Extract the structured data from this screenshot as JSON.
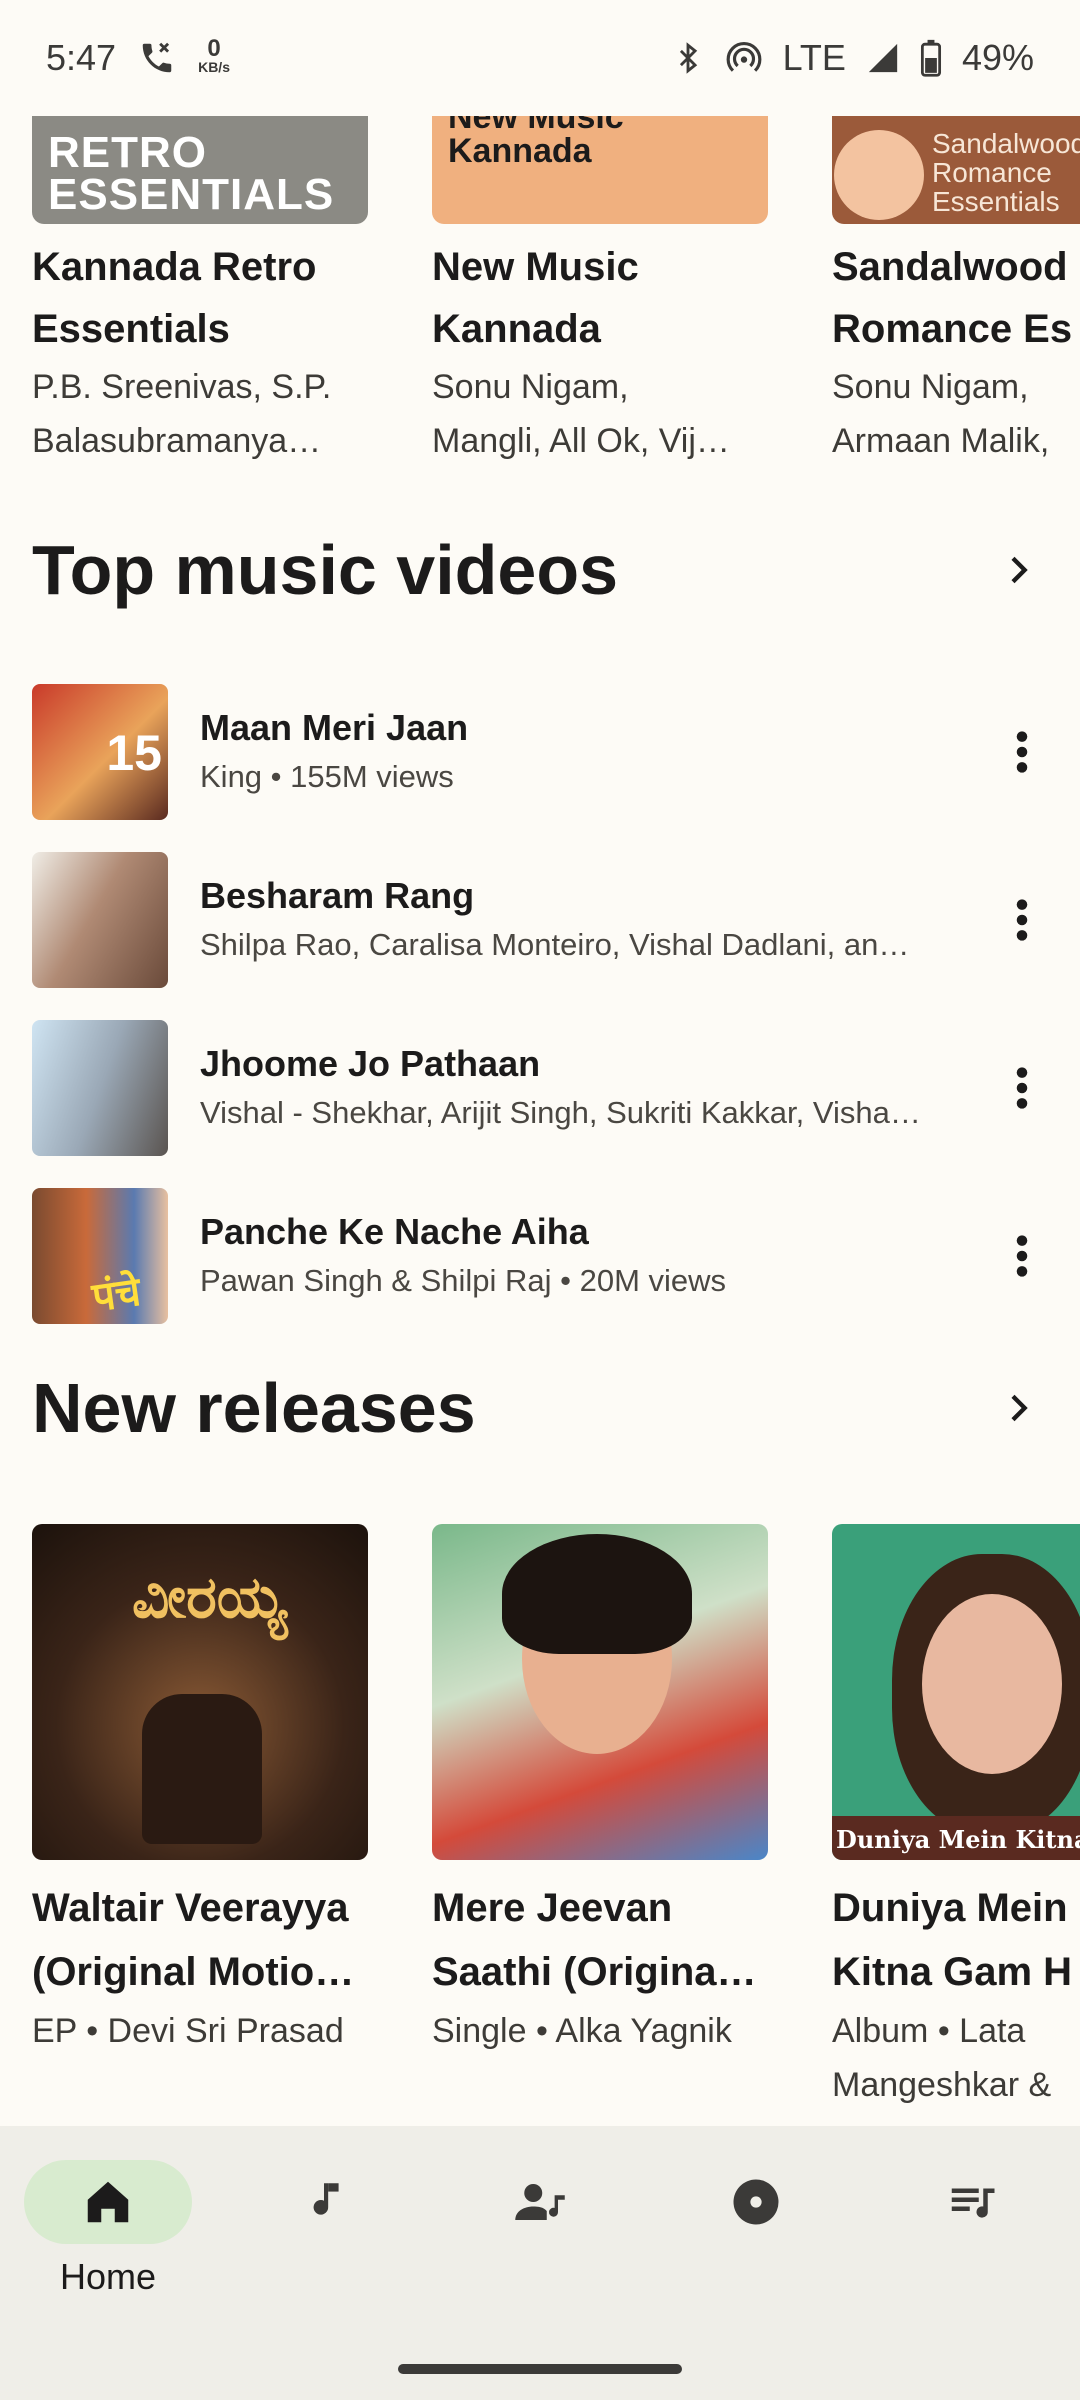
{
  "status_bar": {
    "time": "5:47",
    "data_rate_value": "0",
    "data_rate_unit": "KB/s",
    "network": "LTE",
    "battery": "49%"
  },
  "top_playlists": [
    {
      "art_text": "RETRO\nESSENTIALS",
      "title_line1": "Kannada Retro",
      "title_line2": "Essentials",
      "sub_line1": "P.B. Sreenivas, S.P.",
      "sub_line2": "Balasubramanya…"
    },
    {
      "art_text": "New Music\nKannada",
      "title_line1": "New Music",
      "title_line2": "Kannada",
      "sub_line1": "Sonu Nigam,",
      "sub_line2": "Mangli, All Ok, Vij…"
    },
    {
      "art_text": "Sandalwood\nRomance\nEssentials",
      "title_line1": "Sandalwood",
      "title_line2": "Romance Es",
      "sub_line1": "Sonu Nigam,",
      "sub_line2": "Armaan Malik,"
    }
  ],
  "top_videos": {
    "title": "Top music videos",
    "items": [
      {
        "title": "Maan Meri Jaan",
        "subtitle": "King • 155M views"
      },
      {
        "title": "Besharam Rang",
        "subtitle": "Shilpa Rao, Caralisa Monteiro, Vishal Dadlani, and…"
      },
      {
        "title": "Jhoome Jo Pathaan",
        "subtitle": "Vishal - Shekhar, Arijit Singh, Sukriti Kakkar, Vishal…"
      },
      {
        "title": "Panche Ke Nache Aiha",
        "subtitle": "Pawan Singh & Shilpi Raj • 20M views"
      }
    ]
  },
  "new_releases": {
    "title": "New releases",
    "items": [
      {
        "title_line1": "Waltair Veerayya",
        "title_line2": "(Original Motio…",
        "sub_line1": "EP • Devi Sri Prasad",
        "sub_line2": ""
      },
      {
        "title_line1": "Mere Jeevan",
        "title_line2": "Saathi (Origina…",
        "sub_line1": "Single • Alka Yagnik",
        "sub_line2": ""
      },
      {
        "title_line1": "Duniya Mein",
        "title_line2": "Kitna Gam H",
        "sub_line1": "Album • Lata",
        "sub_line2": "Mangeshkar &"
      }
    ]
  },
  "bottom_nav": {
    "home_label": "Home"
  },
  "colors": {
    "background": "#fdfbf6",
    "nav_background": "#efeee8",
    "nav_active_pill": "#d8ebcf",
    "text_primary": "#1c1b1b"
  }
}
